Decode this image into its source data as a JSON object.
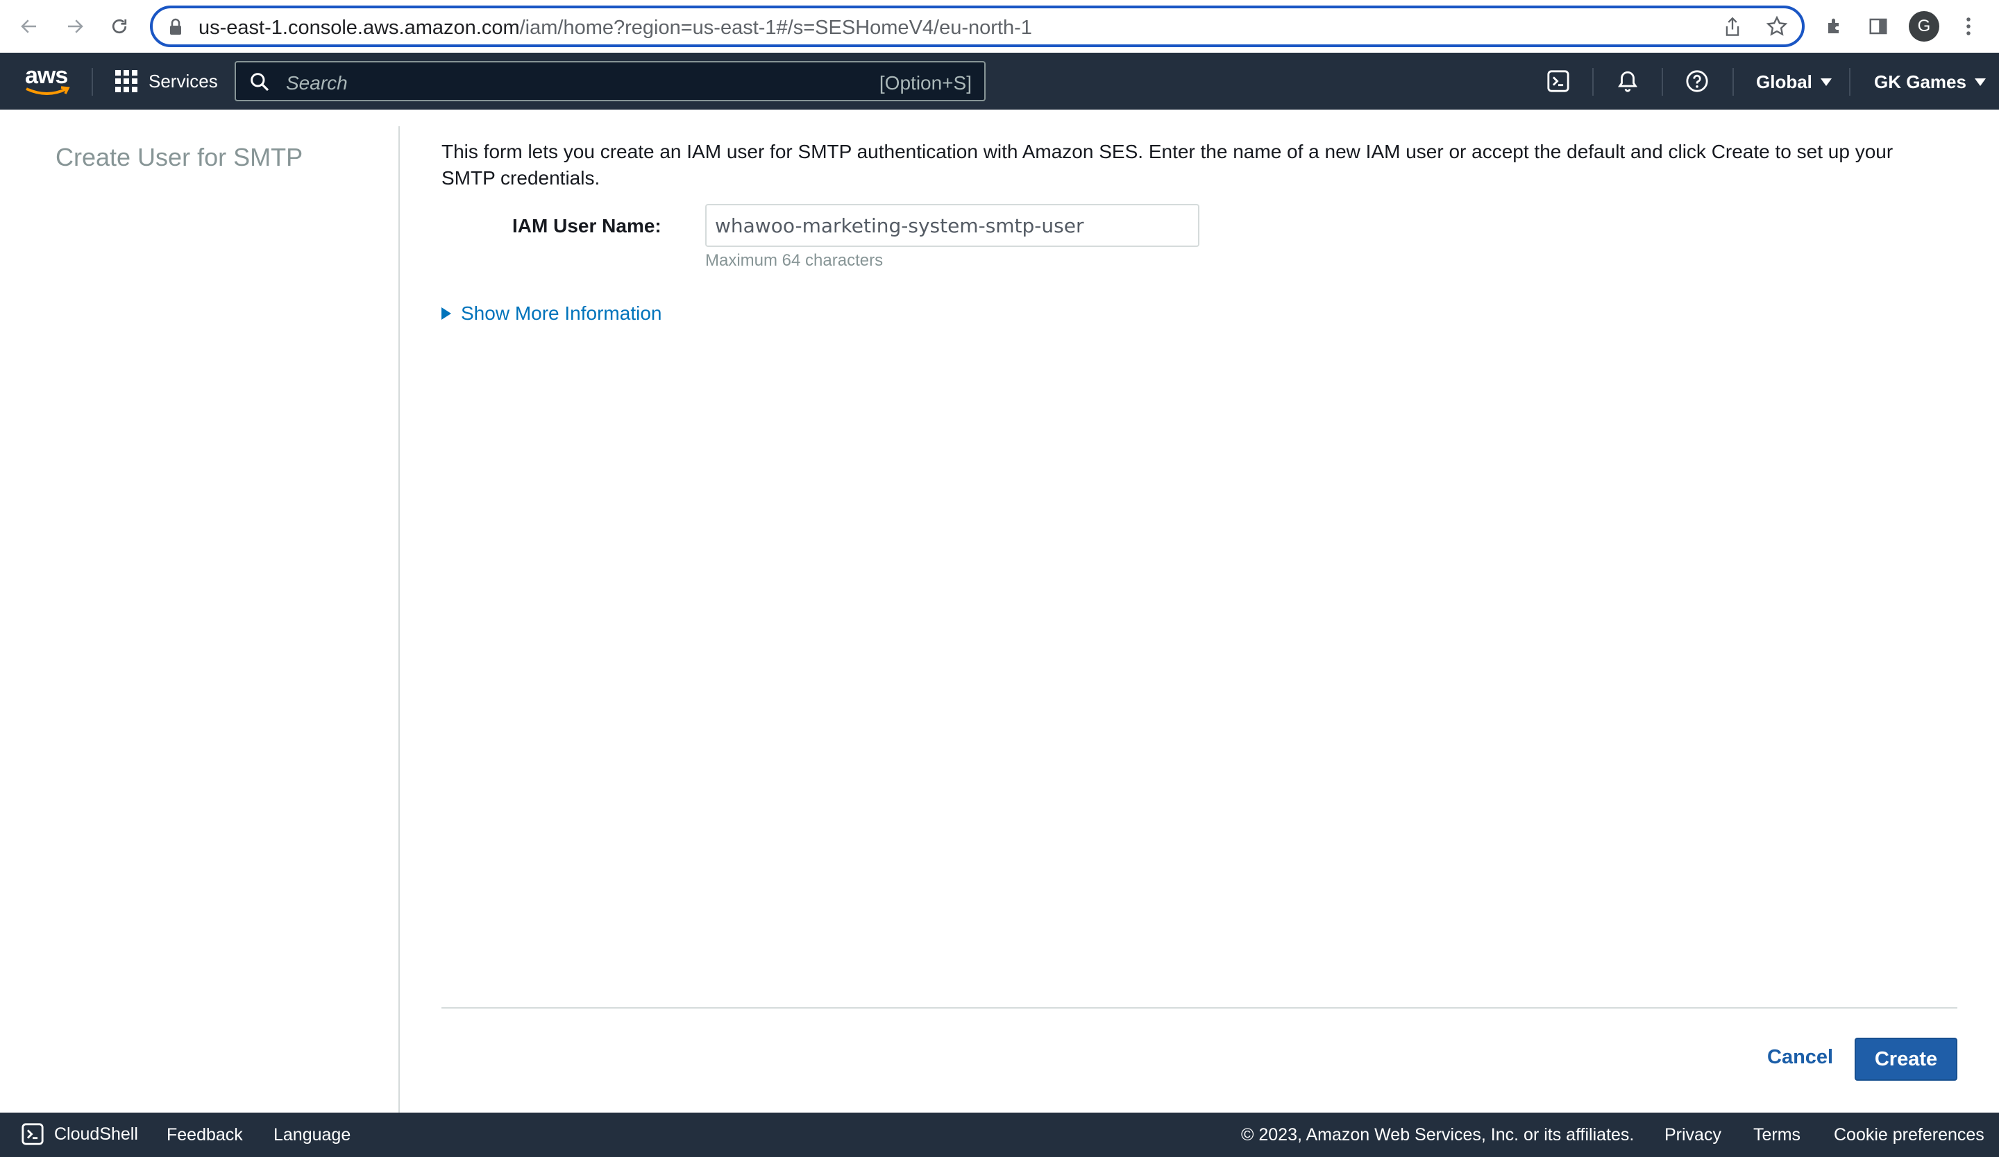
{
  "browser": {
    "url_host": "us-east-1.console.aws.amazon.com",
    "url_path": "/iam/home?region=us-east-1#/s=SESHomeV4/eu-north-1",
    "profile_initial": "G"
  },
  "aws_header": {
    "logo_text": "aws",
    "services_label": "Services",
    "search_placeholder": "Search",
    "search_shortcut": "[Option+S]",
    "region_label": "Global",
    "account_label": "GK Games"
  },
  "left_panel": {
    "title": "Create User for SMTP"
  },
  "form": {
    "intro": "This form lets you create an IAM user for SMTP authentication with Amazon SES. Enter the name of a new IAM user or accept the default and click Create to set up your SMTP credentials.",
    "iam_user_name_label": "IAM User Name:",
    "iam_user_name_value": "whawoo-marketing-system-smtp-user",
    "iam_user_name_hint": "Maximum 64 characters",
    "show_more_label": "Show More Information",
    "cancel_label": "Cancel",
    "create_label": "Create"
  },
  "footer": {
    "cloudshell_label": "CloudShell",
    "feedback_label": "Feedback",
    "language_label": "Language",
    "copyright": "© 2023, Amazon Web Services, Inc. or its affiliates.",
    "privacy_label": "Privacy",
    "terms_label": "Terms",
    "cookie_label": "Cookie preferences"
  },
  "colors": {
    "aws_navy": "#232f3e",
    "link_blue": "#0073bb",
    "primary_button": "#1f5ea8",
    "aws_orange": "#ff9900"
  }
}
